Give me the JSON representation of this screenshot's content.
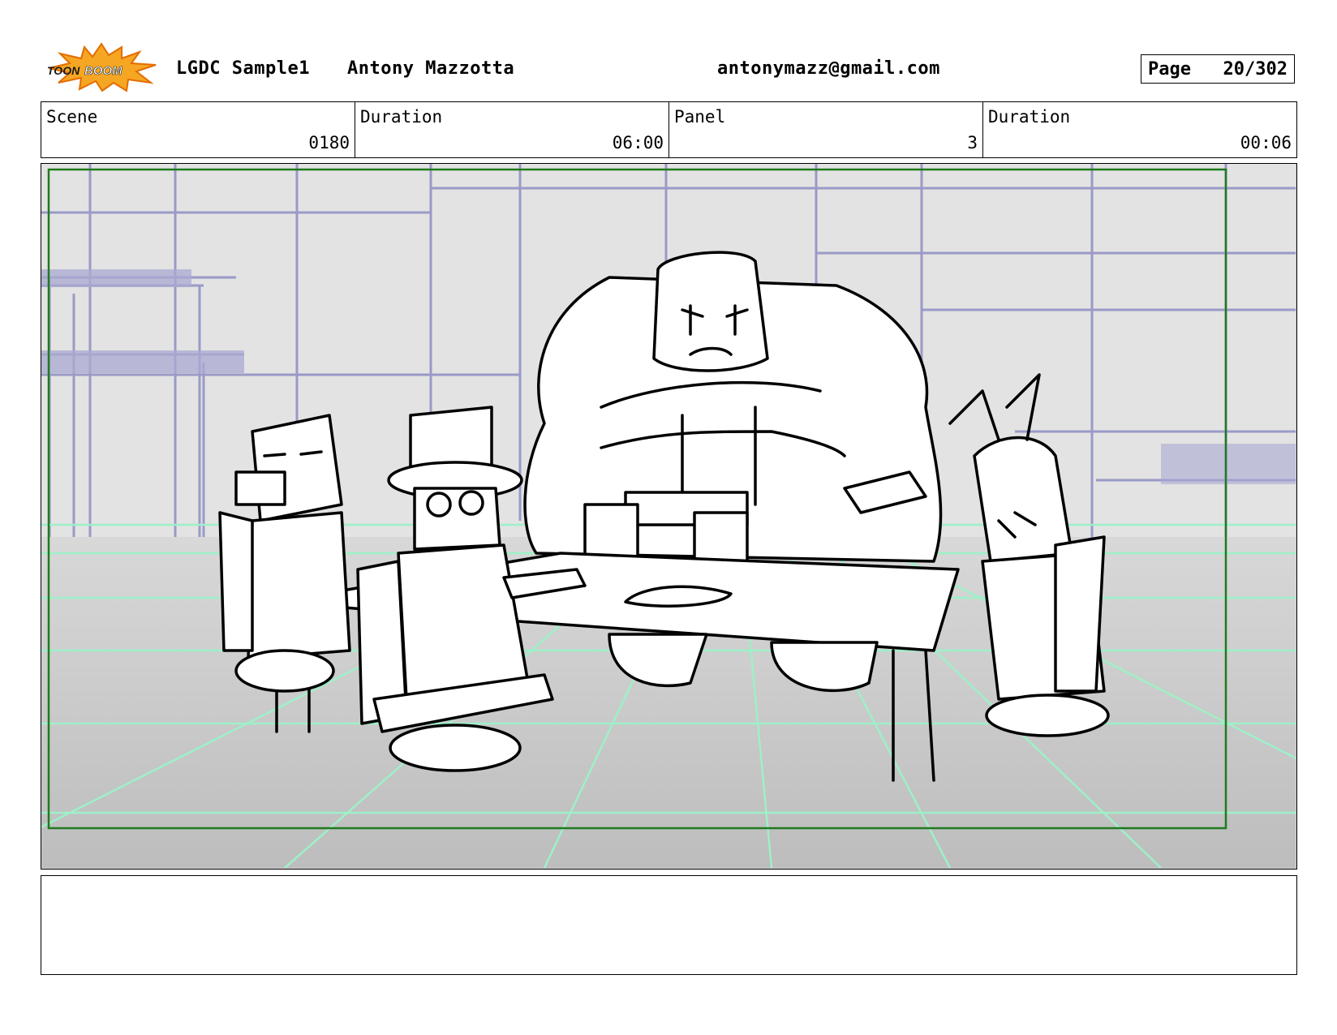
{
  "header": {
    "logo_text": "TOONBOOM",
    "project": "LGDC Sample1",
    "author": "Antony Mazzotta",
    "email": "antonymazz@gmail.com",
    "page_label": "Page",
    "page_value": "20/302"
  },
  "info": {
    "scene_label": "Scene",
    "scene_value": "0180",
    "duration_label": "Duration",
    "duration_value": "06:00",
    "panel_label": "Panel",
    "panel_value": "3",
    "panel_duration_label": "Duration",
    "panel_duration_value": "00:06"
  },
  "panel": {
    "safe_frame_color": "#1f7a1f",
    "wall_line_color": "#9a9ac8",
    "floor_line_color": "#9ef0c8"
  },
  "notes": {
    "text": ""
  }
}
